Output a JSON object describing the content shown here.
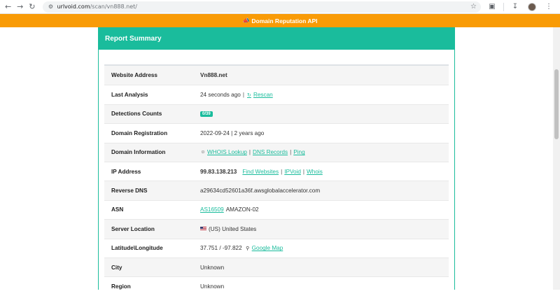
{
  "browser": {
    "url_host": "urlvoid.com",
    "url_path": "/scan/vn888.net/",
    "icons": [
      "back-icon",
      "forward-icon",
      "reload-icon",
      "site-info-icon",
      "star-icon",
      "extensions-icon",
      "download-icon",
      "profile-avatar",
      "menu-icon"
    ]
  },
  "banner": {
    "text": "Domain Reputation API",
    "icon": "bullhorn-icon",
    "color": "#f99b06"
  },
  "card": {
    "title": "Report Summary",
    "accent": "#1abc9c",
    "rows": {
      "website_address": {
        "label": "Website Address",
        "value": "Vn888.net"
      },
      "last_analysis": {
        "label": "Last Analysis",
        "time": "24 seconds ago",
        "sep": "|",
        "rescan": "Rescan"
      },
      "detections": {
        "label": "Detections Counts",
        "badge": "0/39"
      },
      "registration": {
        "label": "Domain Registration",
        "value": "2022-09-24 | 2 years ago"
      },
      "domain_info": {
        "label": "Domain Information",
        "whois": "WHOIS Lookup",
        "sep1": "|",
        "dns": "DNS Records",
        "sep2": "|",
        "ping": "Ping"
      },
      "ip_address": {
        "label": "IP Address",
        "ip": "99.83.138.213",
        "find": "Find Websites",
        "sep1": "|",
        "ipvoid": "IPVoid",
        "sep2": "|",
        "whois": "Whois"
      },
      "reverse_dns": {
        "label": "Reverse DNS",
        "value": "a29634cd52601a36f.awsglobalaccelerator.com"
      },
      "asn": {
        "label": "ASN",
        "asn_link": "AS16509",
        "org": "AMAZON-02"
      },
      "server_location": {
        "label": "Server Location",
        "value": "(US) United States"
      },
      "lat_long": {
        "label": "Latitude\\Longitude",
        "value": "37.751 / -97.822",
        "map": "Google Map"
      },
      "city": {
        "label": "City",
        "value": "Unknown"
      },
      "region": {
        "label": "Region",
        "value": "Unknown"
      }
    }
  }
}
